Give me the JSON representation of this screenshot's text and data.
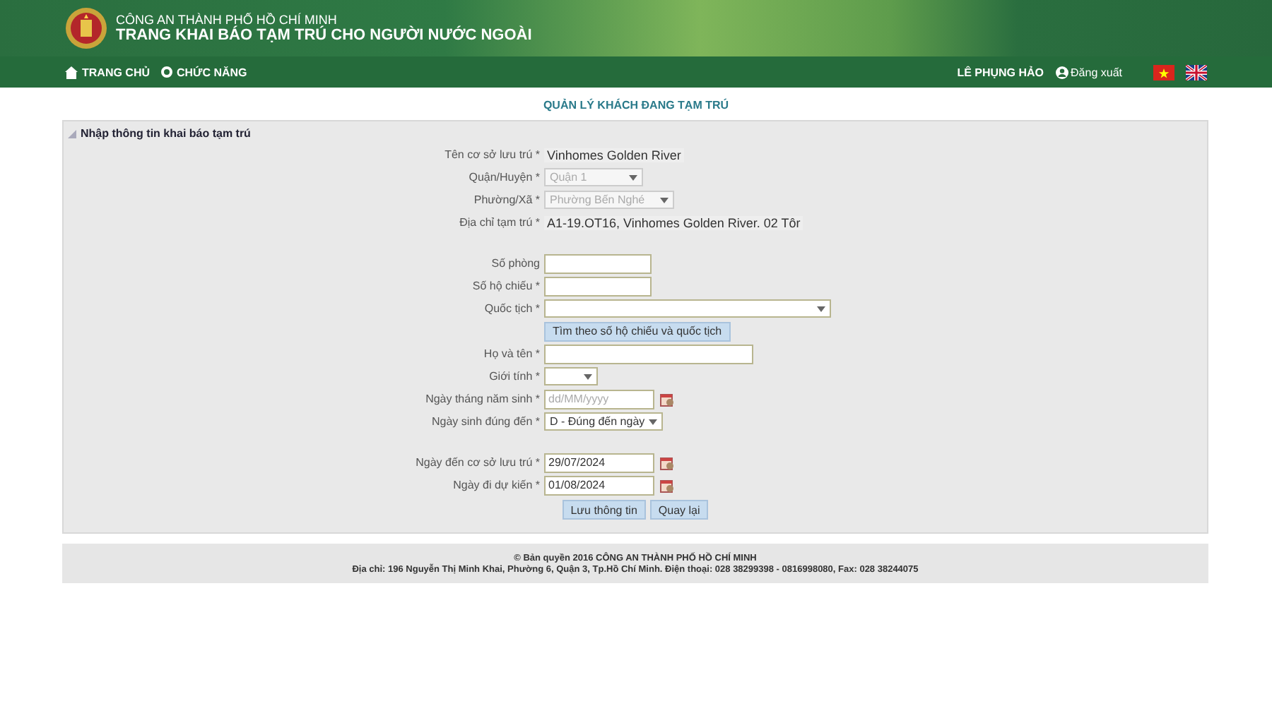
{
  "header": {
    "agency": "CÔNG AN THÀNH PHỐ HỒ CHÍ MINH",
    "title": "TRANG KHAI BÁO TẠM TRÚ CHO NGƯỜI NƯỚC NGOÀI"
  },
  "nav": {
    "items": [
      {
        "label": "TRANG CHỦ",
        "kind": "home"
      },
      {
        "label": "CHỨC NĂNG",
        "kind": "menu"
      }
    ],
    "user": "LÊ PHỤNG HẢO",
    "logout": "Đăng xuất"
  },
  "page_title": "QUẢN LÝ KHÁCH ĐANG TẠM TRÚ",
  "panel": {
    "title": "Nhập thông tin khai báo tạm trú",
    "groups": [
      [
        {
          "kind": "static",
          "label": "Tên cơ sở lưu trú *",
          "value": "Vinhomes Golden River"
        },
        {
          "kind": "select",
          "label": "Quận/Huyện *",
          "value": "Quận 1",
          "disabled": true
        },
        {
          "kind": "select",
          "label": "Phường/Xã *",
          "value": "Phường Bến Nghé",
          "disabled": true
        },
        {
          "kind": "static",
          "label": "Địa chỉ tạm trú *",
          "value": "A1-19.OT16, Vinhomes Golden River. 02 Tôr"
        }
      ],
      [
        {
          "kind": "input",
          "label": "Số phòng"
        },
        {
          "kind": "input",
          "label": "Số hộ chiếu *"
        },
        {
          "kind": "select",
          "label": "Quốc tịch *",
          "disabled": false
        },
        {
          "kind": "button",
          "value": "Tìm theo số hộ chiếu và quốc tịch"
        },
        {
          "kind": "input",
          "label": "Họ và tên *"
        },
        {
          "kind": "select",
          "label": "Giới tính *",
          "disabled": false
        },
        {
          "kind": "date",
          "label": "Ngày tháng năm sinh *",
          "placeholder": "dd/MM/yyyy"
        },
        {
          "kind": "select",
          "label": "Ngày sinh đúng đến *",
          "value": "D - Đúng đến ngày",
          "disabled": false
        }
      ],
      [
        {
          "kind": "date",
          "label": "Ngày đến cơ sở lưu trú *",
          "value": "29/07/2024"
        },
        {
          "kind": "date",
          "label": "Ngày đi dự kiến *",
          "value": "01/08/2024"
        }
      ]
    ],
    "buttons": [
      "Lưu thông tin",
      "Quay lại"
    ]
  },
  "footer": {
    "copyright": "© Bản quyền 2016 CÔNG AN THÀNH PHỐ HỒ CHÍ MINH",
    "address": "Địa chỉ: 196 Nguyễn Thị Minh Khai, Phường 6, Quận 3, Tp.Hồ Chí Minh. Điện thoại: 028 38299398 - 0816998080, Fax: 028 38244075"
  }
}
